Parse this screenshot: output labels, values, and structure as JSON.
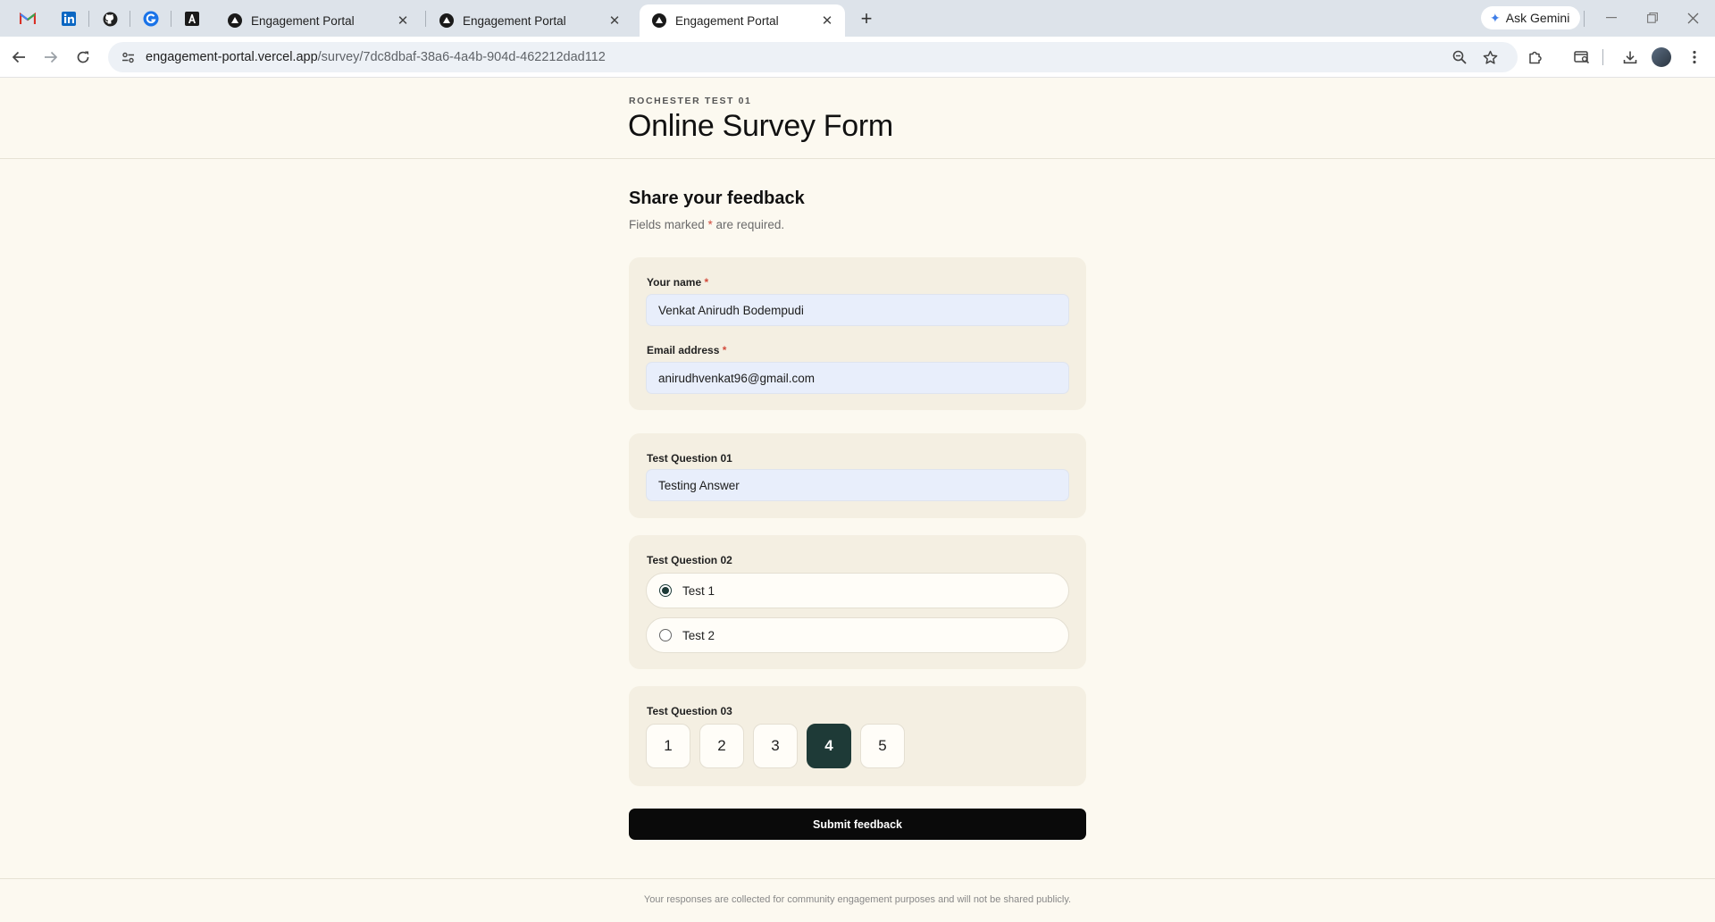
{
  "browser": {
    "tabs": [
      {
        "title": "Engagement Portal",
        "active": false
      },
      {
        "title": "Engagement Portal",
        "active": false
      },
      {
        "title": "Engagement Portal",
        "active": true
      }
    ],
    "close_glyph": "✕",
    "new_tab_glyph": "+",
    "gemini_label": "Ask Gemini",
    "url_host": "engagement-portal.vercel.app",
    "url_path": "/survey/7dc8dbaf-38a6-4a4b-904d-462212dad112"
  },
  "page": {
    "eyebrow": "ROCHESTER TEST 01",
    "title": "Online Survey Form"
  },
  "form": {
    "heading": "Share your feedback",
    "required_note_prefix": "Fields marked ",
    "required_marker": "*",
    "required_note_suffix": " are required.",
    "name_label": "Your name",
    "name_value": "Venkat Anirudh Bodempudi",
    "email_label": "Email address",
    "email_value": "anirudhvenkat96@gmail.com",
    "q1_label": "Test Question 01",
    "q1_value": "Testing Answer",
    "q2_label": "Test Question 02",
    "q2_options": [
      "Test 1",
      "Test 2"
    ],
    "q2_selected": "Test 1",
    "q3_label": "Test Question 03",
    "q3_options": [
      "1",
      "2",
      "3",
      "4",
      "5"
    ],
    "q3_selected": "4",
    "submit_label": "Submit feedback"
  },
  "footer": {
    "text": "Your responses are collected for community engagement purposes and will not be shared publicly."
  },
  "colors": {
    "page_bg": "#fcf9f0",
    "card_bg": "#f4efe2",
    "accent": "#1e3a37",
    "required": "#d24b3c"
  }
}
